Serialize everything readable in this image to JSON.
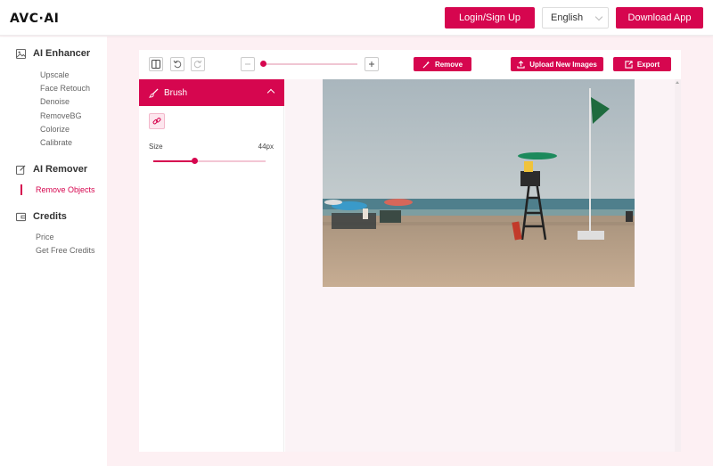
{
  "header": {
    "logo": "AVC·AI",
    "login_label": "Login/Sign Up",
    "language": "English",
    "download_label": "Download App"
  },
  "sidebar": {
    "enhancer": {
      "title": "AI Enhancer",
      "items": [
        "Upscale",
        "Face Retouch",
        "Denoise",
        "RemoveBG",
        "Colorize",
        "Calibrate"
      ]
    },
    "remover": {
      "title": "AI Remover",
      "items": [
        "Remove Objects"
      ]
    },
    "credits": {
      "title": "Credits",
      "items": [
        "Price",
        "Get Free Credits"
      ]
    }
  },
  "toolbar": {
    "remove_label": "Remove",
    "upload_label": "Upload New Images",
    "export_label": "Export",
    "zoom_level": 0.02
  },
  "brush": {
    "title": "Brush",
    "size_label": "Size",
    "size_value": "44px",
    "size_fraction": 0.37
  },
  "colors": {
    "accent": "#d6064f",
    "accent_light": "#fde6ee",
    "page_bg": "#fdf0f3"
  }
}
